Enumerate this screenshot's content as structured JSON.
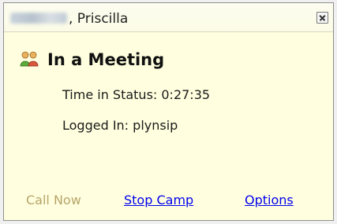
{
  "window": {
    "title_name": ", Priscilla"
  },
  "status": {
    "title": "In a Meeting",
    "time_in_status": "Time in Status: 0:27:35",
    "logged_in": "Logged In: plynsip"
  },
  "actions": {
    "call_now": "Call Now",
    "stop_camp": "Stop Camp",
    "options": "Options"
  },
  "colors": {
    "background": "#ffffdf",
    "link": "#0000ee",
    "disabled_link": "#b8a46a"
  },
  "icons": {
    "status": "people-meeting-icon",
    "close": "close-icon"
  }
}
